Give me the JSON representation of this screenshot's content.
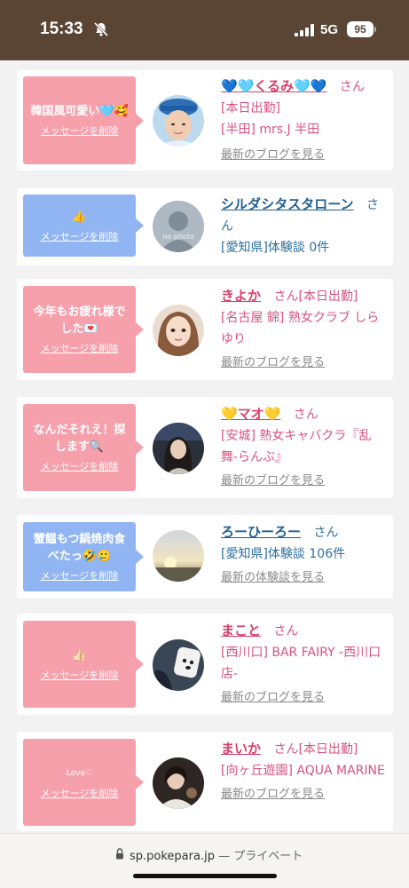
{
  "status": {
    "time": "15:33",
    "network": "5G",
    "battery": "95",
    "icons": [
      "bell-slash-icon",
      "signal-icon"
    ]
  },
  "colors": {
    "pink_bubble": "#f6a0ac",
    "blue_bubble": "#90b5f2",
    "pink_text": "#d9406a",
    "blue_text": "#1f5f92",
    "status_bar": "#5a4535"
  },
  "cards": [
    {
      "message": "韓国風可愛い🩵🥰",
      "message_color": "pink",
      "delete_label": "メッセージを削除",
      "name": "💙🩵くるみ🩵💙",
      "suffix": "さん",
      "status_tag": "",
      "lines": [
        "[本日出勤]",
        "[半田] mrs.J 半田"
      ],
      "link": "最新のブログを見る"
    },
    {
      "message": "👍",
      "message_color": "blue",
      "delete_label": "メッセージを削除",
      "name": "シルダシタスタローン",
      "suffix": "さん",
      "status_tag": "",
      "lines": [
        "[愛知県]体験談 0件"
      ],
      "link": "",
      "avatar_text": "no photo"
    },
    {
      "message": "今年もお疲れ様でした💌",
      "message_color": "pink",
      "delete_label": "メッセージを削除",
      "name": "きよか",
      "suffix": "さん",
      "status_tag": "[本日出勤]",
      "lines": [
        "[名古屋 錦] 熟女クラブ しらゆり"
      ],
      "link": "最新のブログを見る"
    },
    {
      "message": "なんだそれえ！探します🔍",
      "message_color": "pink",
      "delete_label": "メッセージを削除",
      "name": "💛マオ💛",
      "suffix": "さん",
      "status_tag": "",
      "lines": [
        "[安城] 熟女キャバクラ『乱舞-らんぶ』"
      ],
      "link": "最新のブログを見る"
    },
    {
      "message": "蟹饂もつ鍋焼肉食べたっ🤣🥲",
      "message_color": "blue",
      "delete_label": "メッセージを削除",
      "name": "ろーひーろー",
      "suffix": "さん",
      "status_tag": "",
      "lines": [
        "[愛知県]体験談 106件"
      ],
      "link": "最新の体験談を見る"
    },
    {
      "message": "👍🏻",
      "message_color": "pink",
      "delete_label": "メッセージを削除",
      "name": "まこと",
      "suffix": "さん",
      "status_tag": "",
      "lines": [
        "[西川口] BAR FAIRY -西川口店-"
      ],
      "link": "最新のブログを見る"
    },
    {
      "message": "Love♡",
      "message_color": "pink",
      "delete_label": "メッセージを削除",
      "name": "まいか",
      "suffix": "さん",
      "status_tag": "[本日出勤]",
      "lines": [
        "[向ヶ丘遊園] AQUA MARINE"
      ],
      "link": "最新のブログを見る"
    }
  ],
  "browser": {
    "domain": "sp.pokepara.jp",
    "mode": "— プライベート"
  }
}
